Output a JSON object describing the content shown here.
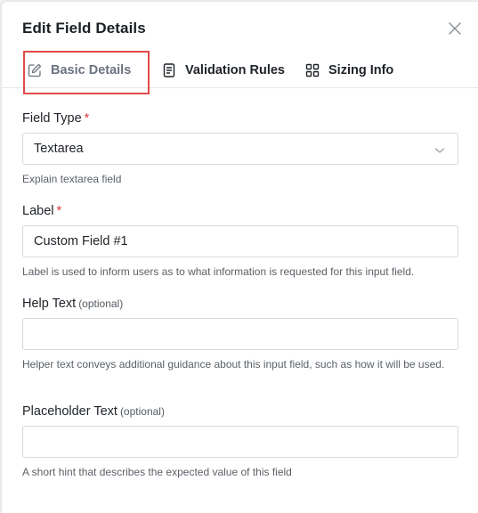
{
  "modal": {
    "title": "Edit Field Details"
  },
  "tabs": [
    {
      "label": "Basic Details",
      "icon": "edit-icon",
      "active": true
    },
    {
      "label": "Validation Rules",
      "icon": "document-icon",
      "active": false
    },
    {
      "label": "Sizing Info",
      "icon": "grid-icon",
      "active": false
    }
  ],
  "fields": {
    "field_type": {
      "label": "Field Type",
      "required": "*",
      "value": "Textarea",
      "hint": "Explain textarea field"
    },
    "label": {
      "label": "Label",
      "required": "*",
      "value": "Custom Field #1",
      "hint": "Label is used to inform users as to what information is requested for this input field."
    },
    "help_text": {
      "label": "Help Text",
      "optional": "(optional)",
      "value": "",
      "hint": "Helper text conveys additional guidance about this input field, such as how it will be used."
    },
    "placeholder_text": {
      "label": "Placeholder Text",
      "optional": "(optional)",
      "value": "",
      "hint": "A short hint that describes the expected value of this field"
    }
  },
  "colors": {
    "highlight": "#e34a4a",
    "required": "#d93c3c"
  }
}
